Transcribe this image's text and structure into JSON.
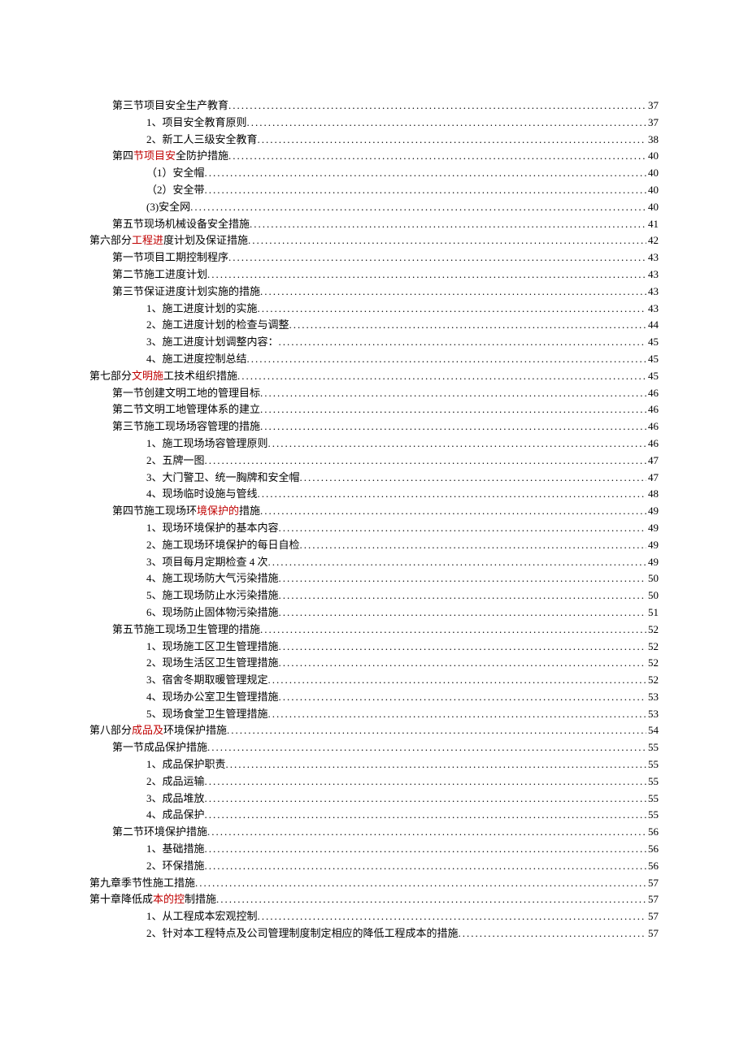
{
  "toc": [
    {
      "level": 1,
      "title": "第三节项目安全生产教育",
      "page": "37",
      "highlight": ""
    },
    {
      "level": 2,
      "title": "1、项目安全教育原则",
      "page": "37",
      "highlight": ""
    },
    {
      "level": 2,
      "title": "2、新工人三级安全教育",
      "page": "38",
      "highlight": ""
    },
    {
      "level": 1,
      "title": "第四节项目安全防护措施",
      "page": "40",
      "highlight": "节项目安"
    },
    {
      "level": 2,
      "title": "（1）安全帽",
      "page": "40",
      "highlight": ""
    },
    {
      "level": 2,
      "title": "（2）安全带",
      "page": "40",
      "highlight": ""
    },
    {
      "level": 3,
      "title": "(3)安全网",
      "page": "40",
      "highlight": ""
    },
    {
      "level": 1,
      "title": "第五节现场机械设备安全措施",
      "page": "41",
      "highlight": ""
    },
    {
      "level": 0,
      "title": "第六部分工程进度计划及保证措施",
      "page": "42",
      "highlight": "工程进"
    },
    {
      "level": 1,
      "title": "第一节项目工期控制程序",
      "page": "43",
      "highlight": ""
    },
    {
      "level": 1,
      "title": "第二节施工进度计划",
      "page": "43",
      "highlight": ""
    },
    {
      "level": 1,
      "title": "第三节保证进度计划实施的措施",
      "page": "43",
      "highlight": ""
    },
    {
      "level": 2,
      "title": "1、施工进度计划的实施",
      "page": "43",
      "highlight": ""
    },
    {
      "level": 2,
      "title": "2、施工进度计划的检查与调整",
      "page": "44",
      "highlight": ""
    },
    {
      "level": 2,
      "title": "3、施工进度计划调整内容：",
      "page": "45",
      "highlight": ""
    },
    {
      "level": 2,
      "title": "4、施工进度控制总结",
      "page": "45",
      "highlight": ""
    },
    {
      "level": 0,
      "title": "第七部分文明施工技术组织措施",
      "page": "45",
      "highlight": "文明施"
    },
    {
      "level": 1,
      "title": "第一节创建文明工地的管理目标",
      "page": "46",
      "highlight": ""
    },
    {
      "level": 1,
      "title": "第二节文明工地管理体系的建立",
      "page": "46",
      "highlight": ""
    },
    {
      "level": 1,
      "title": "第三节施工现场场容管理的措施",
      "page": "46",
      "highlight": ""
    },
    {
      "level": 2,
      "title": "1、施工现场场容管理原则",
      "page": "46",
      "highlight": ""
    },
    {
      "level": 2,
      "title": "2、五牌一图",
      "page": "47",
      "highlight": ""
    },
    {
      "level": 2,
      "title": "3、大门警卫、统一胸牌和安全帽",
      "page": "47",
      "highlight": ""
    },
    {
      "level": 2,
      "title": "4、现场临时设施与管线",
      "page": "48",
      "highlight": ""
    },
    {
      "level": 1,
      "title": "第四节施工现场环境保护的措施",
      "page": "49",
      "highlight": "境保护的"
    },
    {
      "level": 2,
      "title": "1、现场环境保护的基本内容",
      "page": "49",
      "highlight": ""
    },
    {
      "level": 2,
      "title": "2、施工现场环境保护的每日自检",
      "page": "49",
      "highlight": ""
    },
    {
      "level": 2,
      "title": "3、项目每月定期检查 4 次",
      "page": "49",
      "highlight": ""
    },
    {
      "level": 2,
      "title": "4、施工现场防大气污染措施",
      "page": "50",
      "highlight": ""
    },
    {
      "level": 2,
      "title": "5、施工现场防止水污染措施",
      "page": "50",
      "highlight": ""
    },
    {
      "level": 2,
      "title": "6、现场防止固体物污染措施",
      "page": "51",
      "highlight": ""
    },
    {
      "level": 1,
      "title": "第五节施工现场卫生管理的措施",
      "page": "52",
      "highlight": ""
    },
    {
      "level": 2,
      "title": "1、现场施工区卫生管理措施",
      "page": "52",
      "highlight": ""
    },
    {
      "level": 2,
      "title": "2、现场生活区卫生管理措施",
      "page": "52",
      "highlight": ""
    },
    {
      "level": 2,
      "title": "3、宿舍冬期取暖管理规定",
      "page": "52",
      "highlight": ""
    },
    {
      "level": 2,
      "title": "4、现场办公室卫生管理措施",
      "page": "53",
      "highlight": ""
    },
    {
      "level": 2,
      "title": "5、现场食堂卫生管理措施",
      "page": "53",
      "highlight": ""
    },
    {
      "level": 0,
      "title": "第八部分成品及环境保护措施",
      "page": "54",
      "highlight": "成品及"
    },
    {
      "level": 1,
      "title": "第一节成品保护措施",
      "page": "55",
      "highlight": ""
    },
    {
      "level": 2,
      "title": "1、成品保护职责",
      "page": "55",
      "highlight": ""
    },
    {
      "level": 2,
      "title": "2、成品运输",
      "page": "55",
      "highlight": ""
    },
    {
      "level": 2,
      "title": "3、成品堆放",
      "page": "55",
      "highlight": ""
    },
    {
      "level": 2,
      "title": "4、成品保护",
      "page": "55",
      "highlight": ""
    },
    {
      "level": 1,
      "title": "第二节环境保护措施",
      "page": "56",
      "highlight": ""
    },
    {
      "level": 2,
      "title": "1、基础措施",
      "page": "56",
      "highlight": ""
    },
    {
      "level": 2,
      "title": "2、环保措施",
      "page": "56",
      "highlight": ""
    },
    {
      "level": 0,
      "title": "第九章季节性施工措施",
      "page": "57",
      "highlight": ""
    },
    {
      "level": 0,
      "title": "第十章降低成本的控制措施",
      "page": "57",
      "highlight": "本的控"
    },
    {
      "level": 2,
      "title": "1、从工程成本宏观控制",
      "page": "57",
      "highlight": ""
    },
    {
      "level": 2,
      "title": "2、针对本工程特点及公司管理制度制定相应的降低工程成本的措施",
      "page": "57",
      "highlight": ""
    }
  ]
}
